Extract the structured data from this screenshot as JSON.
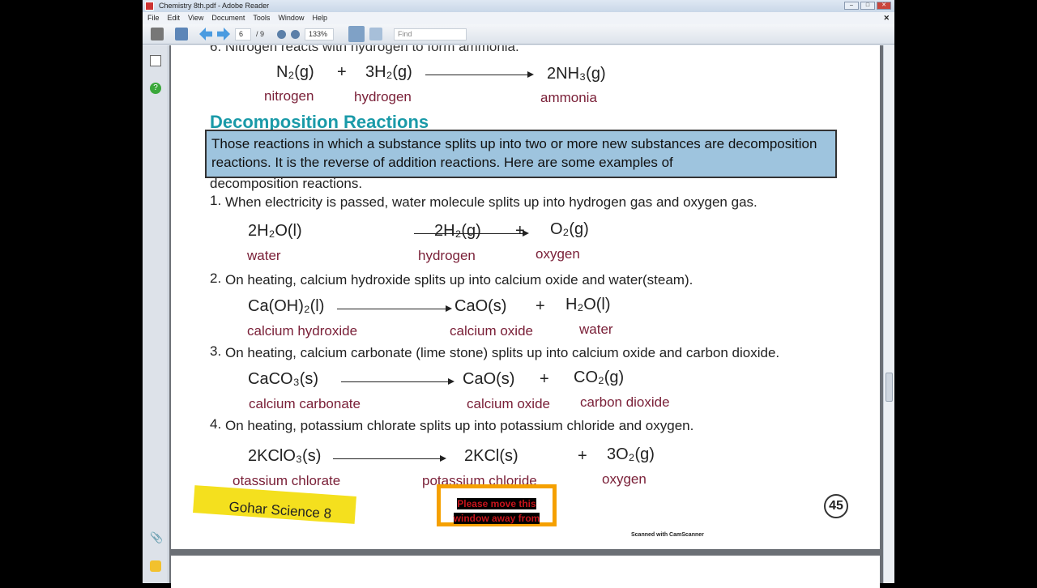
{
  "window": {
    "title": "Chemistry 8th.pdf - Adobe Reader"
  },
  "menu": [
    "File",
    "Edit",
    "View",
    "Document",
    "Tools",
    "Window",
    "Help"
  ],
  "toolbar": {
    "page_current": "6",
    "page_total": "/ 9",
    "zoom": "133%",
    "find_placeholder": "Find"
  },
  "doc": {
    "top_eq": {
      "left": "N₂(g)",
      "plus": "+",
      "mid": "3H₂(g)",
      "right": "2NH₃(g)",
      "l1": "nitrogen",
      "l2": "hydrogen",
      "l3": "ammonia",
      "cut": "6. Nitrogen reacts with hydrogen to form ammonia."
    },
    "heading": "Decomposition Reactions",
    "definition": "Those reactions in which a substance splits up into two or more new substances are decomposition reactions. It is the reverse of addition reactions. Here are some examples of",
    "definition_tail": "decomposition reactions.",
    "items": [
      {
        "num": "1.",
        "text": "When electricity is passed, water molecule splits up into hydrogen gas and oxygen gas.",
        "reactant": "2H₂O(l)",
        "p1": "2H₂(g)",
        "plus": "+",
        "p2": "O₂(g)",
        "lr": "water",
        "lp1": "hydrogen",
        "lp2": "oxygen"
      },
      {
        "num": "2.",
        "text": "On heating, calcium hydroxide splits up into calcium oxide and water(steam).",
        "reactant": "Ca(OH)₂(l)",
        "p1": "CaO(s)",
        "plus": "+",
        "p2": "H₂O(l)",
        "lr": "calcium hydroxide",
        "lp1": "calcium oxide",
        "lp2": "water"
      },
      {
        "num": "3.",
        "text": "On heating, calcium carbonate (lime stone) splits up into calcium oxide and carbon dioxide.",
        "reactant": "CaCO₃(s)",
        "p1": "CaO(s)",
        "plus": "+",
        "p2": "CO₂(g)",
        "lr": "calcium carbonate",
        "lp1": "calcium oxide",
        "lp2": "carbon dioxide"
      },
      {
        "num": "4.",
        "text": "On heating, potassium chlorate splits up into potassium chloride and oxygen.",
        "reactant": "2KClO₃(s)",
        "p1": "2KCl(s)",
        "plus": "+",
        "p2": "3O₂(g)",
        "lr": "otassium chlorate",
        "lp1": "potassium chloride",
        "lp2": "oxygen"
      }
    ],
    "footer_banner": "Gohar Science 8",
    "page_number": "45",
    "scanned": "Scanned with CamScanner"
  },
  "overlay": {
    "line1": "Please move this",
    "line2": "window away from"
  }
}
